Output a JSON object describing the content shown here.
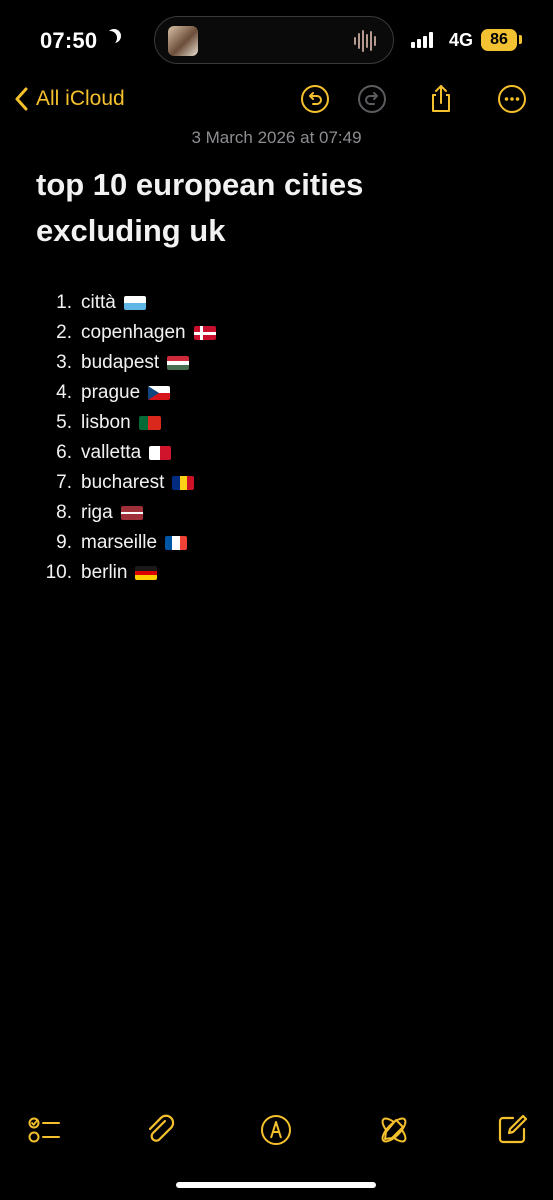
{
  "status_bar": {
    "time": "07:50",
    "network": "4G",
    "battery": "86",
    "icons": [
      "moon-icon",
      "waveform-icon",
      "signal-icon"
    ]
  },
  "nav": {
    "back_label": "All iCloud",
    "icons": [
      "chevron-left-icon",
      "undo-icon",
      "redo-icon",
      "share-icon",
      "more-icon"
    ]
  },
  "note": {
    "date": "3 March 2026 at 07:49",
    "title": "top 10 european cities excluding uk",
    "items": [
      {
        "number": "1.",
        "city": "città",
        "flag": "flag-san-marino-icon"
      },
      {
        "number": "2.",
        "city": "copenhagen",
        "flag": "flag-denmark-icon"
      },
      {
        "number": "3.",
        "city": "budapest",
        "flag": "flag-hungary-icon"
      },
      {
        "number": "4.",
        "city": "prague",
        "flag": "flag-czechia-icon"
      },
      {
        "number": "5.",
        "city": "lisbon",
        "flag": "flag-portugal-icon"
      },
      {
        "number": "6.",
        "city": "valletta",
        "flag": "flag-malta-icon"
      },
      {
        "number": "7.",
        "city": "bucharest",
        "flag": "flag-romania-icon"
      },
      {
        "number": "8.",
        "city": "riga",
        "flag": "flag-latvia-icon"
      },
      {
        "number": "9.",
        "city": "marseille",
        "flag": "flag-france-icon"
      },
      {
        "number": "10.",
        "city": "berlin",
        "flag": "flag-germany-icon"
      }
    ]
  },
  "toolbar": {
    "icons": [
      "checklist-icon",
      "paperclip-icon",
      "markup-pen-icon",
      "writing-tools-icon",
      "compose-icon"
    ]
  },
  "colors": {
    "accent": "#f5c02e",
    "background": "#000000",
    "date_text": "#8d8d92"
  }
}
